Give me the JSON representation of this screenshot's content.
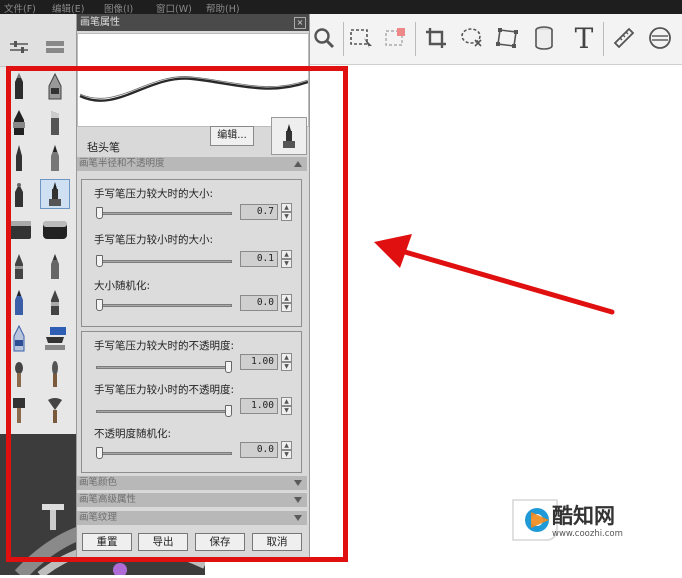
{
  "menu": [
    "文件(F)",
    "编辑(E)",
    "图像(I)",
    "窗口(W)",
    "帮助(H)"
  ],
  "panel": {
    "title": "画笔属性",
    "brush_name": "毡头笔",
    "edit_button": "编辑...",
    "section_size": "画笔半径和不透明度",
    "sliders_size": [
      {
        "label": "手写笔压力较大时的大小:",
        "value": "0.7",
        "fraction": 0.0
      },
      {
        "label": "手写笔压力较小时的大小:",
        "value": "0.1",
        "fraction": 0.0
      },
      {
        "label": "大小随机化:",
        "value": "0.0",
        "fraction": 0.0
      }
    ],
    "sliders_opacity": [
      {
        "label": "手写笔压力较大时的不透明度:",
        "value": "1.00",
        "fraction": 1.0
      },
      {
        "label": "手写笔压力较小时的不透明度:",
        "value": "1.00",
        "fraction": 1.0
      },
      {
        "label": "不透明度随机化:",
        "value": "0.0",
        "fraction": 0.0
      }
    ],
    "section_color": "画笔颜色",
    "section_advanced": "画笔高级属性",
    "section_texture": "画笔纹理",
    "buttons": {
      "reset": "重置",
      "export": "导出",
      "save": "保存",
      "cancel": "取消"
    }
  },
  "toolbar_icons": [
    "zoom-icon",
    "marquee-select-icon",
    "crop-transform-icon",
    "crop-icon",
    "lasso-icon",
    "distort-icon",
    "fill-bucket-icon",
    "text-icon",
    "ruler-icon",
    "ellipse-guide-icon"
  ],
  "text_tool_glyph": "T",
  "watermark": {
    "brand": "酷知网",
    "url": "www.coozhi.com"
  },
  "colors": {
    "annotation": "#e01010",
    "selection": "#cfe0f3"
  }
}
